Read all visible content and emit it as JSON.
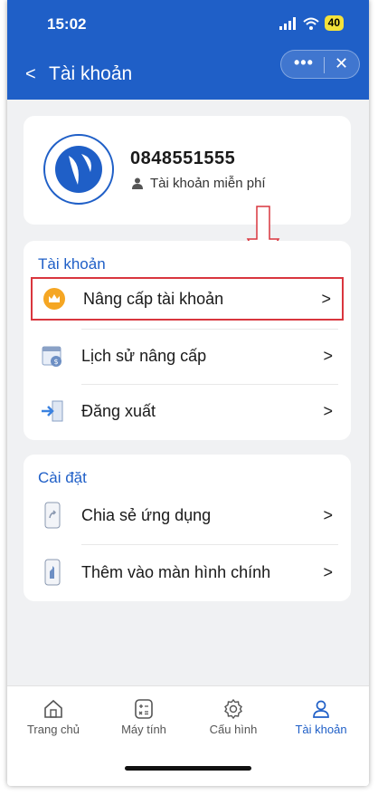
{
  "status_bar": {
    "time": "15:02",
    "battery": "40"
  },
  "header": {
    "title": "Tài khoản",
    "back_icon": "chevron-left-icon",
    "menu_label": "•••",
    "close_label": "✕"
  },
  "profile": {
    "phone": "0848551555",
    "account_type": "Tài khoản miễn phí"
  },
  "account_section": {
    "title": "Tài khoản",
    "items": [
      {
        "label": "Nâng cấp tài khoản",
        "icon": "crown-icon"
      },
      {
        "label": "Lịch sử nâng cấp",
        "icon": "calendar-history-icon"
      },
      {
        "label": "Đăng xuất",
        "icon": "logout-door-icon"
      }
    ]
  },
  "settings_section": {
    "title": "Cài đặt",
    "items": [
      {
        "label": "Chia sẻ ứng dụng",
        "icon": "share-phone-icon"
      },
      {
        "label": "Thêm vào màn hình chính",
        "icon": "add-home-screen-icon"
      }
    ]
  },
  "tabs": [
    {
      "label": "Trang chủ",
      "icon": "home-icon"
    },
    {
      "label": "Máy tính",
      "icon": "calculator-icon"
    },
    {
      "label": "Cấu hình",
      "icon": "gear-icon"
    },
    {
      "label": "Tài khoản",
      "icon": "user-icon",
      "active": true
    }
  ],
  "colors": {
    "primary": "#1f5fc7",
    "highlight": "#d9363e",
    "crown": "#f5a623"
  }
}
